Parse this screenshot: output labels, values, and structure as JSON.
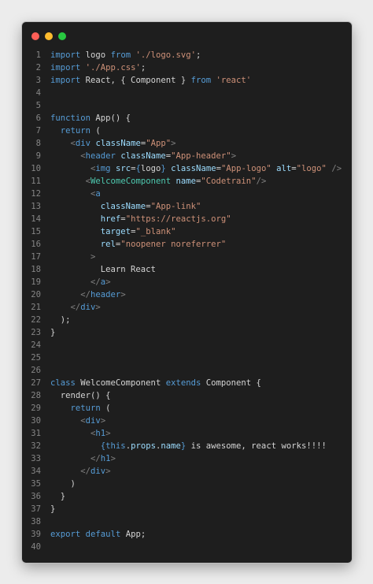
{
  "colors": {
    "background": "#1e1e1e",
    "keyword": "#569cd6",
    "string": "#ce9178",
    "attribute": "#9cdcfe",
    "component": "#4ec9b0",
    "punctuation": "#808080",
    "default": "#d4d4d4",
    "line_number": "#858585",
    "dot_red": "#ff5f57",
    "dot_yellow": "#febc2e",
    "dot_green": "#28c840"
  },
  "window_controls": [
    "close-dot",
    "minimize-dot",
    "zoom-dot"
  ],
  "code_lines": [
    {
      "n": "1",
      "tokens": [
        [
          "k",
          "import"
        ],
        [
          "d",
          " logo "
        ],
        [
          "k",
          "from"
        ],
        [
          "d",
          " "
        ],
        [
          "s",
          "'./logo.svg'"
        ],
        [
          "d",
          ";"
        ]
      ]
    },
    {
      "n": "2",
      "tokens": [
        [
          "k",
          "import"
        ],
        [
          "d",
          " "
        ],
        [
          "s",
          "'./App.css'"
        ],
        [
          "d",
          ";"
        ]
      ]
    },
    {
      "n": "3",
      "tokens": [
        [
          "k",
          "import"
        ],
        [
          "d",
          " React, { Component } "
        ],
        [
          "k",
          "from"
        ],
        [
          "d",
          " "
        ],
        [
          "s",
          "'react'"
        ]
      ]
    },
    {
      "n": "4",
      "tokens": []
    },
    {
      "n": "5",
      "tokens": []
    },
    {
      "n": "6",
      "tokens": [
        [
          "k",
          "function"
        ],
        [
          "d",
          " App() {"
        ]
      ]
    },
    {
      "n": "7",
      "tokens": [
        [
          "d",
          "  "
        ],
        [
          "k",
          "return"
        ],
        [
          "d",
          " ("
        ]
      ]
    },
    {
      "n": "8",
      "tokens": [
        [
          "d",
          "    "
        ],
        [
          "p",
          "<"
        ],
        [
          "t",
          "div"
        ],
        [
          "d",
          " "
        ],
        [
          "a",
          "className"
        ],
        [
          "d",
          "="
        ],
        [
          "s",
          "\"App\""
        ],
        [
          "p",
          ">"
        ]
      ]
    },
    {
      "n": "9",
      "tokens": [
        [
          "d",
          "      "
        ],
        [
          "p",
          "<"
        ],
        [
          "t",
          "header"
        ],
        [
          "d",
          " "
        ],
        [
          "a",
          "className"
        ],
        [
          "d",
          "="
        ],
        [
          "s",
          "\"App-header\""
        ],
        [
          "p",
          ">"
        ]
      ]
    },
    {
      "n": "10",
      "tokens": [
        [
          "d",
          "        "
        ],
        [
          "p",
          "<"
        ],
        [
          "t",
          "img"
        ],
        [
          "d",
          " "
        ],
        [
          "a",
          "src"
        ],
        [
          "d",
          "="
        ],
        [
          "k",
          "{"
        ],
        [
          "d",
          "logo"
        ],
        [
          "k",
          "}"
        ],
        [
          "d",
          " "
        ],
        [
          "a",
          "className"
        ],
        [
          "d",
          "="
        ],
        [
          "s",
          "\"App-logo\""
        ],
        [
          "d",
          " "
        ],
        [
          "a",
          "alt"
        ],
        [
          "d",
          "="
        ],
        [
          "s",
          "\"logo\""
        ],
        [
          "d",
          " "
        ],
        [
          "p",
          "/>"
        ]
      ]
    },
    {
      "n": "11",
      "tokens": [
        [
          "d",
          "       "
        ],
        [
          "p",
          "<"
        ],
        [
          "c",
          "WelcomeComponent"
        ],
        [
          "d",
          " "
        ],
        [
          "a",
          "name"
        ],
        [
          "d",
          "="
        ],
        [
          "s",
          "\"Codetrain\""
        ],
        [
          "p",
          "/>"
        ]
      ]
    },
    {
      "n": "12",
      "tokens": [
        [
          "d",
          "        "
        ],
        [
          "p",
          "<"
        ],
        [
          "t",
          "a"
        ]
      ]
    },
    {
      "n": "13",
      "tokens": [
        [
          "d",
          "          "
        ],
        [
          "a",
          "className"
        ],
        [
          "d",
          "="
        ],
        [
          "s",
          "\"App-link\""
        ]
      ]
    },
    {
      "n": "14",
      "tokens": [
        [
          "d",
          "          "
        ],
        [
          "a",
          "href"
        ],
        [
          "d",
          "="
        ],
        [
          "s",
          "\"https://reactjs.org\""
        ]
      ]
    },
    {
      "n": "15",
      "tokens": [
        [
          "d",
          "          "
        ],
        [
          "a",
          "target"
        ],
        [
          "d",
          "="
        ],
        [
          "s",
          "\"_blank\""
        ]
      ]
    },
    {
      "n": "16",
      "tokens": [
        [
          "d",
          "          "
        ],
        [
          "a",
          "rel"
        ],
        [
          "d",
          "="
        ],
        [
          "s",
          "\"noopener noreferrer\""
        ]
      ]
    },
    {
      "n": "17",
      "tokens": [
        [
          "d",
          "        "
        ],
        [
          "p",
          ">"
        ]
      ]
    },
    {
      "n": "18",
      "tokens": [
        [
          "d",
          "          Learn React"
        ]
      ]
    },
    {
      "n": "19",
      "tokens": [
        [
          "d",
          "        "
        ],
        [
          "p",
          "</"
        ],
        [
          "t",
          "a"
        ],
        [
          "p",
          ">"
        ]
      ]
    },
    {
      "n": "20",
      "tokens": [
        [
          "d",
          "      "
        ],
        [
          "p",
          "</"
        ],
        [
          "t",
          "header"
        ],
        [
          "p",
          ">"
        ]
      ]
    },
    {
      "n": "21",
      "tokens": [
        [
          "d",
          "    "
        ],
        [
          "p",
          "</"
        ],
        [
          "t",
          "div"
        ],
        [
          "p",
          ">"
        ]
      ]
    },
    {
      "n": "22",
      "tokens": [
        [
          "d",
          "  );"
        ]
      ]
    },
    {
      "n": "23",
      "tokens": [
        [
          "d",
          "}"
        ]
      ]
    },
    {
      "n": "24",
      "tokens": []
    },
    {
      "n": "25",
      "tokens": []
    },
    {
      "n": "26",
      "tokens": []
    },
    {
      "n": "27",
      "tokens": [
        [
          "k",
          "class"
        ],
        [
          "d",
          " WelcomeComponent "
        ],
        [
          "k",
          "extends"
        ],
        [
          "d",
          " Component {"
        ]
      ]
    },
    {
      "n": "28",
      "tokens": [
        [
          "d",
          "  render() {"
        ]
      ]
    },
    {
      "n": "29",
      "tokens": [
        [
          "d",
          "    "
        ],
        [
          "k",
          "return"
        ],
        [
          "d",
          " ("
        ]
      ]
    },
    {
      "n": "30",
      "tokens": [
        [
          "d",
          "      "
        ],
        [
          "p",
          "<"
        ],
        [
          "t",
          "div"
        ],
        [
          "p",
          ">"
        ]
      ]
    },
    {
      "n": "31",
      "tokens": [
        [
          "d",
          "        "
        ],
        [
          "p",
          "<"
        ],
        [
          "t",
          "h1"
        ],
        [
          "p",
          ">"
        ]
      ]
    },
    {
      "n": "32",
      "tokens": [
        [
          "d",
          "          "
        ],
        [
          "k",
          "{"
        ],
        [
          "k",
          "this"
        ],
        [
          "d",
          "."
        ],
        [
          "a",
          "props"
        ],
        [
          "d",
          "."
        ],
        [
          "a",
          "name"
        ],
        [
          "k",
          "}"
        ],
        [
          "d",
          " is awesome, react works!!!!"
        ]
      ]
    },
    {
      "n": "33",
      "tokens": [
        [
          "d",
          "        "
        ],
        [
          "p",
          "</"
        ],
        [
          "t",
          "h1"
        ],
        [
          "p",
          ">"
        ]
      ]
    },
    {
      "n": "34",
      "tokens": [
        [
          "d",
          "      "
        ],
        [
          "p",
          "</"
        ],
        [
          "t",
          "div"
        ],
        [
          "p",
          ">"
        ]
      ]
    },
    {
      "n": "35",
      "tokens": [
        [
          "d",
          "    )"
        ]
      ]
    },
    {
      "n": "36",
      "tokens": [
        [
          "d",
          "  }"
        ]
      ]
    },
    {
      "n": "37",
      "tokens": [
        [
          "d",
          "}"
        ]
      ]
    },
    {
      "n": "38",
      "tokens": []
    },
    {
      "n": "39",
      "tokens": [
        [
          "k",
          "export"
        ],
        [
          "d",
          " "
        ],
        [
          "k",
          "default"
        ],
        [
          "d",
          " App;"
        ]
      ]
    },
    {
      "n": "40",
      "tokens": []
    }
  ]
}
